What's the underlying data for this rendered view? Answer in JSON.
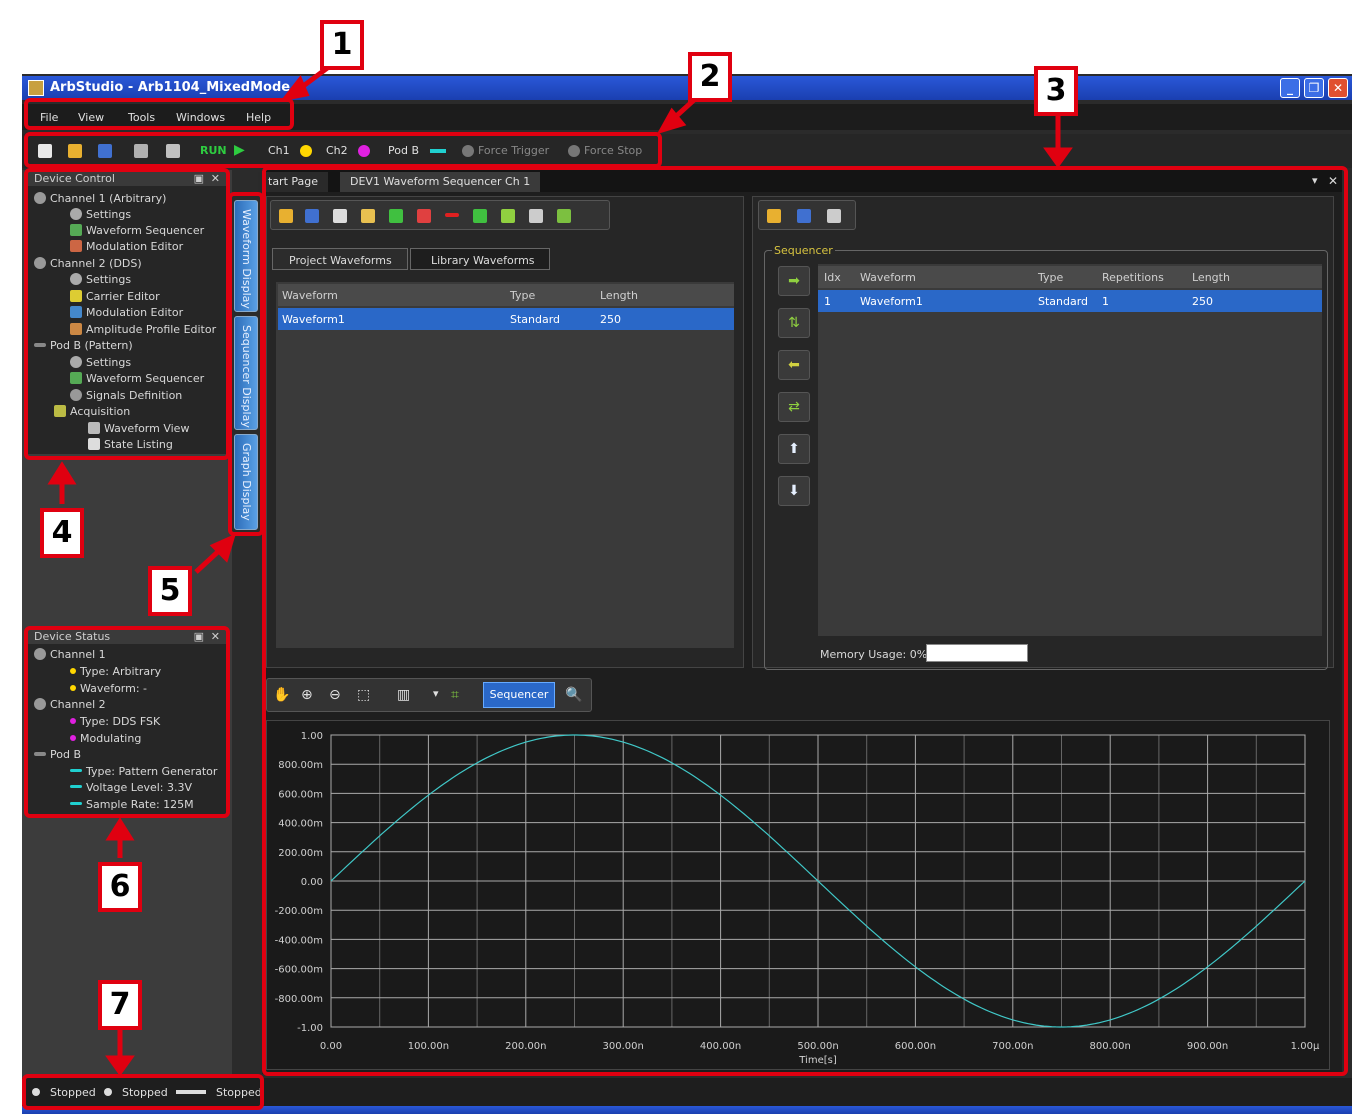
{
  "window": {
    "title": "ArbStudio - Arb1104_MixedMode",
    "controls": [
      "_",
      "❐",
      "✕"
    ]
  },
  "menu": [
    "File",
    "View",
    "Tools",
    "Windows",
    "Help"
  ],
  "toolbar": {
    "run_label": "RUN",
    "ch1_label": "Ch1",
    "ch2_label": "Ch2",
    "podb_label": "Pod B",
    "force_trigger_label": "Force Trigger",
    "force_stop_label": "Force Stop",
    "colors": {
      "run": "#2ecc40",
      "ch1": "#ffd700",
      "ch2": "#e020e0",
      "podb": "#20d0d0"
    }
  },
  "device_control": {
    "title": "Device Control",
    "pin": "📌",
    "close": "✕",
    "items": [
      {
        "label": "Channel 1 (Arbitrary)",
        "icon": "gear-icon"
      },
      {
        "label": "Settings",
        "icon": "gear-icon"
      },
      {
        "label": "Waveform Sequencer",
        "icon": "list-icon"
      },
      {
        "label": "Modulation Editor",
        "icon": "modulation-icon"
      },
      {
        "label": "Channel 2 (DDS)",
        "icon": "gear-icon"
      },
      {
        "label": "Settings",
        "icon": "gear-icon"
      },
      {
        "label": "Carrier Editor",
        "icon": "wave-icon"
      },
      {
        "label": "Modulation Editor",
        "icon": "modulation-icon"
      },
      {
        "label": "Amplitude Profile Editor",
        "icon": "amplitude-icon"
      },
      {
        "label": "Pod B (Pattern)",
        "icon": "bus-icon"
      },
      {
        "label": "Settings",
        "icon": "gear-icon"
      },
      {
        "label": "Waveform Sequencer",
        "icon": "list-icon"
      },
      {
        "label": "Signals Definition",
        "icon": "signals-icon"
      },
      {
        "label": "Acquisition",
        "icon": "folder-icon"
      },
      {
        "label": "Waveform View",
        "icon": "waveform-view-icon"
      },
      {
        "label": "State Listing",
        "icon": "listing-icon"
      }
    ]
  },
  "side_tabs": [
    "Waveform Display",
    "Sequencer Display",
    "Graph Display"
  ],
  "device_status": {
    "title": "Device Status",
    "items": [
      {
        "label": "Channel 1"
      },
      {
        "label": "Type: Arbitrary"
      },
      {
        "label": "Waveform: -"
      },
      {
        "label": "Channel 2"
      },
      {
        "label": "Type: DDS FSK"
      },
      {
        "label": "Modulating"
      },
      {
        "label": "Pod B"
      },
      {
        "label": "Type: Pattern Generator"
      },
      {
        "label": "Voltage Level: 3.3V"
      },
      {
        "label": "Sample Rate: 125M"
      }
    ]
  },
  "document_tabs": [
    "tart Page",
    "DEV1 Waveform Sequencer Ch 1"
  ],
  "waveform_tabs": [
    "Project Waveforms",
    "Library Waveforms"
  ],
  "waveform_table": {
    "headers": [
      "Waveform",
      "Type",
      "Length"
    ],
    "rows": [
      [
        "Waveform1",
        "Standard",
        "250"
      ]
    ]
  },
  "sequencer": {
    "title": "Sequencer",
    "headers": [
      "Idx",
      "Waveform",
      "Type",
      "Repetitions",
      "Length"
    ],
    "rows": [
      [
        "1",
        "Waveform1",
        "Standard",
        "1",
        "250"
      ]
    ],
    "memory_label": "Memory Usage: 0%",
    "buttons": [
      "add-right-arrow-icon",
      "replace-icon",
      "remove-left-arrow-icon",
      "swap-icon",
      "move-up-icon",
      "move-down-icon"
    ]
  },
  "graph_toolbar": {
    "sequencer_button": "Sequencer"
  },
  "chart_data": {
    "type": "line",
    "xlabel": "Time[s]",
    "xticks": [
      "0.00",
      "100.00n",
      "200.00n",
      "300.00n",
      "400.00n",
      "500.00n",
      "600.00n",
      "700.00n",
      "800.00n",
      "900.00n",
      "1.00µ"
    ],
    "yticks": [
      "1.00",
      "800.00m",
      "600.00m",
      "400.00m",
      "200.00m",
      "0.00",
      "-200.00m",
      "-400.00m",
      "-600.00m",
      "-800.00m",
      "-1.00"
    ],
    "xlim": [
      0,
      1e-06
    ],
    "ylim": [
      -1,
      1
    ],
    "grid": true,
    "series": [
      {
        "function": "sin(2*pi*t/1e-6)",
        "samples": 250,
        "color": "#40c8c8"
      }
    ]
  },
  "status_bar": [
    "Stopped",
    "Stopped",
    "Stopped"
  ],
  "callouts": [
    "1",
    "2",
    "3",
    "4",
    "5",
    "6",
    "7"
  ]
}
